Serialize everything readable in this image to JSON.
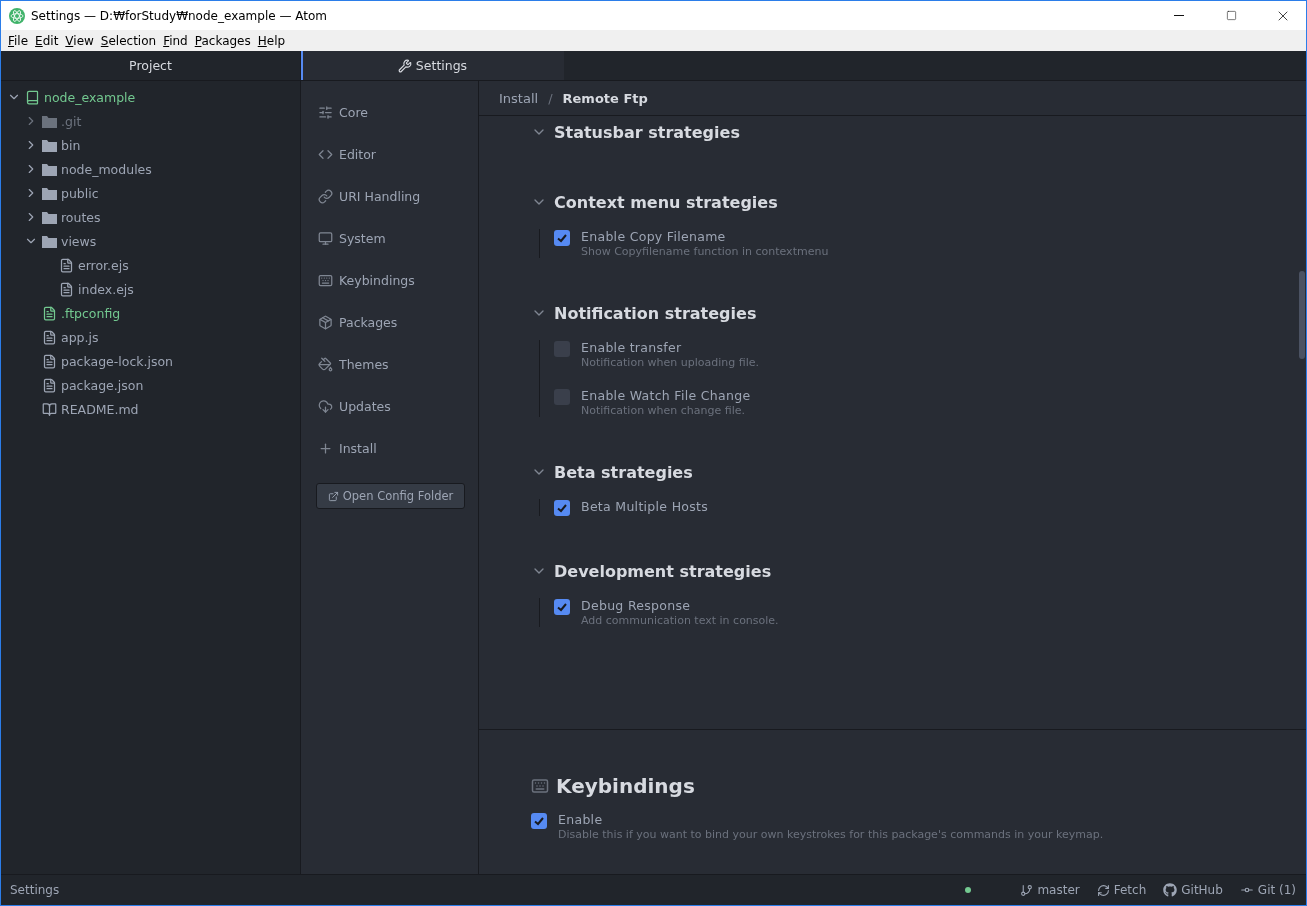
{
  "window": {
    "title": "Settings — D:₩forStudy₩node_example — Atom"
  },
  "menu": [
    "File",
    "Edit",
    "View",
    "Selection",
    "Find",
    "Packages",
    "Help"
  ],
  "tree": {
    "title": "Project",
    "root": {
      "name": "node_example",
      "kind": "repo",
      "added": true,
      "ignored": false,
      "expanded": true,
      "children": [
        {
          "name": ".git",
          "kind": "folder",
          "added": false,
          "ignored": true,
          "expanded": false
        },
        {
          "name": "bin",
          "kind": "folder",
          "added": false,
          "ignored": false,
          "expanded": false
        },
        {
          "name": "node_modules",
          "kind": "folder",
          "added": false,
          "ignored": false,
          "expanded": false
        },
        {
          "name": "public",
          "kind": "folder",
          "added": false,
          "ignored": false,
          "expanded": false
        },
        {
          "name": "routes",
          "kind": "folder",
          "added": false,
          "ignored": false,
          "expanded": false
        },
        {
          "name": "views",
          "kind": "folder",
          "added": false,
          "ignored": false,
          "expanded": true,
          "children": [
            {
              "name": "error.ejs",
              "kind": "file",
              "added": false,
              "ignored": false
            },
            {
              "name": "index.ejs",
              "kind": "file",
              "added": false,
              "ignored": false
            }
          ]
        },
        {
          "name": ".ftpconfig",
          "kind": "file",
          "added": true,
          "ignored": false
        },
        {
          "name": "app.js",
          "kind": "file",
          "added": false,
          "ignored": false
        },
        {
          "name": "package-lock.json",
          "kind": "file",
          "added": false,
          "ignored": false
        },
        {
          "name": "package.json",
          "kind": "file",
          "added": false,
          "ignored": false
        },
        {
          "name": "README.md",
          "kind": "readme",
          "added": false,
          "ignored": false
        }
      ]
    }
  },
  "tabs": [
    {
      "label": "Settings",
      "selected": true
    }
  ],
  "nav": [
    {
      "label": "Core",
      "kind": "core"
    },
    {
      "label": "Editor",
      "kind": "editor"
    },
    {
      "label": "URI Handling",
      "kind": "uri"
    },
    {
      "label": "System",
      "kind": "system"
    },
    {
      "label": "Keybindings",
      "kind": "keybindings"
    },
    {
      "label": "Packages",
      "kind": "packages"
    },
    {
      "label": "Themes",
      "kind": "themes"
    },
    {
      "label": "Updates",
      "kind": "updates"
    },
    {
      "label": "Install",
      "kind": "install"
    }
  ],
  "config_button": "Open Config Folder",
  "breadcrumb": [
    "Install",
    "Remote Ftp"
  ],
  "breadcrumb_separator": "/",
  "sections": [
    {
      "title": "Statusbar strategies",
      "expanded": true
    },
    {
      "title": "Context menu strategies",
      "expanded": true,
      "options": [
        {
          "label": "Enable Copy Filename",
          "description": "Show Copyfilename function in contextmenu",
          "checked": true
        }
      ]
    },
    {
      "title": "Notification strategies",
      "expanded": true,
      "options": [
        {
          "label": "Enable transfer",
          "description": "Notification when uploading file.",
          "checked": false
        },
        {
          "label": "Enable Watch File Change",
          "description": "Notification when change file.",
          "checked": false
        }
      ]
    },
    {
      "title": "Beta strategies",
      "expanded": true,
      "options": [
        {
          "label": "Beta Multiple Hosts",
          "checked": true
        }
      ]
    },
    {
      "title": "Development strategies",
      "expanded": true,
      "options": [
        {
          "label": "Debug Response",
          "description": "Add communication text in console.",
          "checked": true
        }
      ]
    }
  ],
  "keybindings": {
    "title": "Keybindings",
    "option": {
      "label": "Enable",
      "description": "Disable this if you want to bind your own keystrokes for this package's commands in your keymap.",
      "checked": true
    }
  },
  "status_bar": {
    "left": "Settings",
    "items": [
      {
        "kind": "branch",
        "label": "master"
      },
      {
        "kind": "fetch",
        "label": "Fetch"
      },
      {
        "kind": "github",
        "label": "GitHub"
      },
      {
        "kind": "git",
        "label": "Git (1)"
      }
    ]
  }
}
